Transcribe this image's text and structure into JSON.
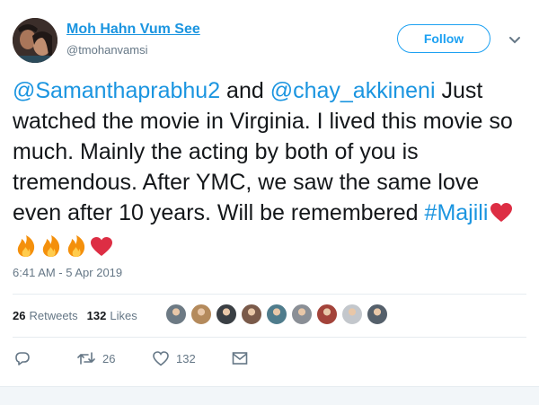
{
  "user": {
    "name": "Moh Hahn Vum See",
    "handle": "@tmohanvamsi"
  },
  "follow_button": {
    "label": "Follow"
  },
  "tweet": {
    "mention1": "@Samanthaprabhu2",
    "and_word": " and ",
    "mention2": "@chay_akkineni",
    "body": " Just watched the movie in Virginia. I lived this movie so much. Mainly the acting by both of you is tremendous. After YMC, we saw the same love even after 10 years. Will be remembered ",
    "hashtag": "#Majili",
    "emojis": [
      "red-heart",
      "fire",
      "fire",
      "fire",
      "red-heart"
    ]
  },
  "timestamp": "6:41 AM - 5 Apr 2019",
  "stats": {
    "retweets_count": "26",
    "retweets_label": "Retweets",
    "likes_count": "132",
    "likes_label": "Likes"
  },
  "liker_avatars": [
    "#6d7a84",
    "#b48a5c",
    "#3a3f44",
    "#7a5a4a",
    "#4f7c8c",
    "#8a8f96",
    "#a3433a",
    "#c3c7cc",
    "#55606b"
  ],
  "actions": {
    "reply_icon": "reply-icon",
    "retweet_count": "26",
    "like_count": "132",
    "message_icon": "envelope-icon"
  },
  "colors": {
    "link": "#1b95e0",
    "follow": "#1da1f2",
    "secondary": "#657786",
    "heart": "#e0245e",
    "fire": "#f4900c"
  }
}
